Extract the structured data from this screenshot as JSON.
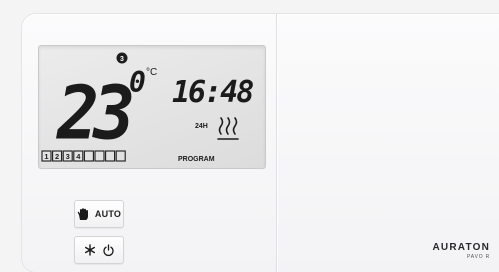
{
  "device": {
    "brand": "AURATON",
    "model": "PAVO R"
  },
  "display": {
    "temperature": "23",
    "temperature_decimal": "0",
    "unit": "°C",
    "time": "16:48",
    "clock_mode": "24H",
    "program_number": "3",
    "program_label": "PROGRAM",
    "day_boxes": [
      "1",
      "2",
      "3",
      "4",
      "",
      "",
      "",
      ""
    ],
    "heating_icon": "heating-waves-icon"
  },
  "buttons": {
    "auto_label": "AUTO",
    "auto_icon": "hand-icon",
    "fan_icon": "snowflake-icon",
    "power_icon": "power-icon"
  }
}
